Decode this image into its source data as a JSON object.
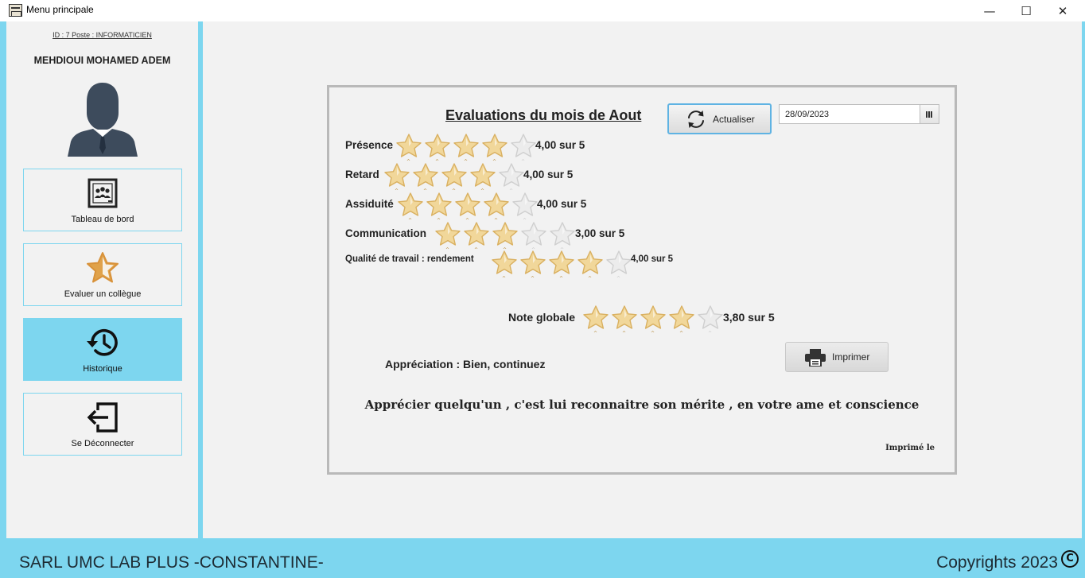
{
  "window": {
    "title": "Menu principale",
    "controls": {
      "minimize": "—",
      "maximize": "☐",
      "close": "✕"
    }
  },
  "sidebar": {
    "user_id": "ID : 7 Poste : INFORMATICIEN",
    "user_name": "MEHDIOUI MOHAMED ADEM",
    "items": [
      {
        "label": "Tableau de bord",
        "icon": "dashboard-icon",
        "active": false
      },
      {
        "label": "Evaluer un collègue",
        "icon": "star-icon",
        "active": false
      },
      {
        "label": "Historique",
        "icon": "history-icon",
        "active": true
      },
      {
        "label": "Se Déconnecter",
        "icon": "logout-icon",
        "active": false
      }
    ]
  },
  "evaluation": {
    "title": "Evaluations du mois de Aout",
    "refresh_label": "Actualiser",
    "date": "28/09/2023",
    "criteria": [
      {
        "label": "Présence",
        "score": 4,
        "max": 5,
        "text": "4,00 sur 5"
      },
      {
        "label": "Retard",
        "score": 4,
        "max": 5,
        "text": "4,00 sur 5"
      },
      {
        "label": "Assiduité",
        "score": 4,
        "max": 5,
        "text": "4,00 sur 5"
      },
      {
        "label": "Communication",
        "score": 3,
        "max": 5,
        "text": "3,00 sur 5"
      },
      {
        "label": "Qualité de travail : rendement",
        "score": 4,
        "max": 5,
        "text": "4,00 sur 5"
      }
    ],
    "global": {
      "label": "Note globale",
      "score": 3.8,
      "max": 5,
      "text": "3,80 sur 5"
    },
    "print_label": "Imprimer",
    "appreciation": "Appréciation : Bien, continuez",
    "quote": "Apprécier quelqu'un , c'est lui reconnaitre son mérite , en votre ame et conscience",
    "printed_label": "Imprimé le"
  },
  "footer": {
    "company": "SARL UMC LAB PLUS -CONSTANTINE-",
    "copyright": "Copyrights 2023",
    "copyright_symbol": "C"
  },
  "colors": {
    "accent": "#7dd6ef",
    "panel": "#f2f2f2",
    "star_on": "#f1d79a",
    "star_off": "#ececec"
  }
}
